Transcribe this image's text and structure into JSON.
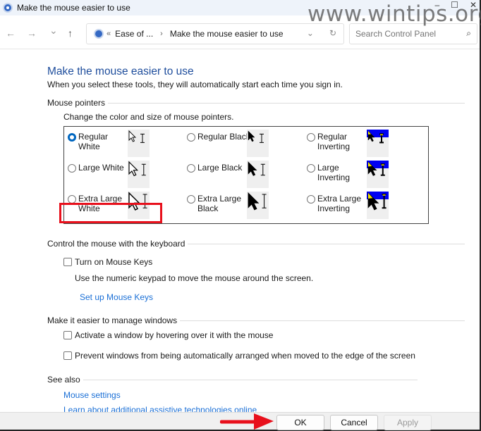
{
  "window": {
    "title": "Make the mouse easier to use",
    "controls": {
      "minimize": "–",
      "maximize": "☐",
      "close": "✕"
    },
    "watermark": "www.wintips.org"
  },
  "navbar": {
    "back": "←",
    "forward": "→",
    "recent": "⌄",
    "up": "↑",
    "breadcrumb_overflow": "«",
    "breadcrumb": [
      "Ease of ...",
      "Make the mouse easier to use"
    ],
    "breadcrumb_separator": "›",
    "dropdown": "⌄",
    "refresh": "↻",
    "search_placeholder": "Search Control Panel",
    "search_icon": "⌕"
  },
  "page": {
    "title": "Make the mouse easier to use",
    "subtitle": "When you select these tools, they will automatically start each time you sign in."
  },
  "mouse_pointers": {
    "heading": "Mouse pointers",
    "description": "Change the color and size of mouse pointers.",
    "options": [
      {
        "label": "Regular White",
        "line1": "Regular",
        "line2": "White",
        "checked": true,
        "style": "white",
        "size": "regular"
      },
      {
        "label": "Regular Black",
        "line1": "Regular Black",
        "line2": "",
        "checked": false,
        "style": "black",
        "size": "regular"
      },
      {
        "label": "Regular Inverting",
        "line1": "Regular",
        "line2": "Inverting",
        "checked": false,
        "style": "inverting",
        "size": "regular"
      },
      {
        "label": "Large White",
        "line1": "Large White",
        "line2": "",
        "checked": false,
        "style": "white",
        "size": "large"
      },
      {
        "label": "Large Black",
        "line1": "Large Black",
        "line2": "",
        "checked": false,
        "style": "black",
        "size": "large"
      },
      {
        "label": "Large Inverting",
        "line1": "Large",
        "line2": "Inverting",
        "checked": false,
        "style": "inverting",
        "size": "large"
      },
      {
        "label": "Extra Large White",
        "line1": "Extra Large",
        "line2": "White",
        "checked": false,
        "style": "white",
        "size": "xl"
      },
      {
        "label": "Extra Large Black",
        "line1": "Extra Large",
        "line2": "Black",
        "checked": false,
        "style": "black",
        "size": "xl"
      },
      {
        "label": "Extra Large Inverting",
        "line1": "Extra Large",
        "line2": "Inverting",
        "checked": false,
        "style": "inverting",
        "size": "xl"
      }
    ]
  },
  "keyboard": {
    "heading": "Control the mouse with the keyboard",
    "mouse_keys_label": "Turn on Mouse Keys",
    "mouse_keys_checked": false,
    "mouse_keys_description": "Use the numeric keypad to move the mouse around the screen.",
    "setup_link": "Set up Mouse Keys"
  },
  "windows": {
    "heading": "Make it easier to manage windows",
    "hover_activate_label": "Activate a window by hovering over it with the mouse",
    "hover_activate_checked": false,
    "prevent_arrange_label": "Prevent windows from being automatically arranged when moved to the edge of the screen",
    "prevent_arrange_checked": false
  },
  "see_also": {
    "heading": "See also",
    "links": [
      "Mouse settings",
      "Learn about additional assistive technologies online"
    ]
  },
  "footer": {
    "ok": "OK",
    "cancel": "Cancel",
    "apply": "Apply"
  },
  "colors": {
    "accent": "#0067c0",
    "link": "#1a6fd6",
    "title": "#1e4d9c",
    "highlight": "#e8101c",
    "invert_band": "#0000f0",
    "invert_tip": "#f5e400"
  }
}
